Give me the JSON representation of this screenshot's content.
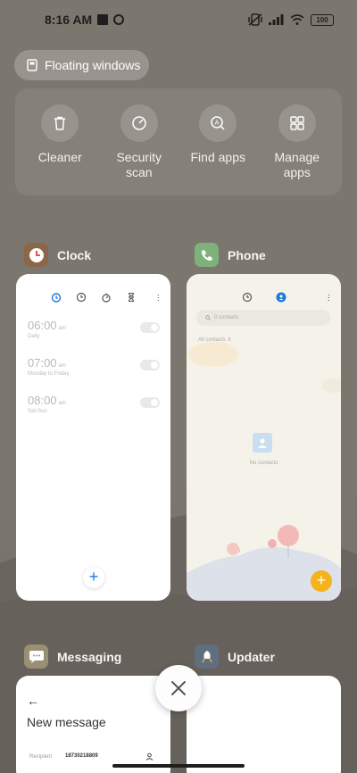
{
  "status_bar": {
    "time": "8:16 AM",
    "battery": "100"
  },
  "floating_windows": {
    "label": "Floating windows"
  },
  "tools": [
    {
      "label": "Cleaner",
      "icon": "trash-icon"
    },
    {
      "label": "Security\nscan",
      "icon": "security-icon"
    },
    {
      "label": "Find apps",
      "icon": "find-apps-icon"
    },
    {
      "label": "Manage\napps",
      "icon": "grid-icon"
    }
  ],
  "apps": {
    "clock": {
      "name": "Clock",
      "alarms": [
        {
          "time": "06:00",
          "ampm": "am",
          "days": "Daily"
        },
        {
          "time": "07:00",
          "ampm": "am",
          "days": "Monday to Friday"
        },
        {
          "time": "08:00",
          "ampm": "am",
          "days": "Sat-Sun"
        }
      ]
    },
    "phone": {
      "name": "Phone",
      "search_placeholder": "0 contacts",
      "filter": "All contacts",
      "empty": "No contacts"
    },
    "messaging": {
      "name": "Messaging",
      "back": "←",
      "title": "New message",
      "recipient_label": "Recipient",
      "recipient_number": "18730218809"
    },
    "updater": {
      "name": "Updater"
    }
  },
  "colors": {
    "clock_accent": "#1a7ad9",
    "phone_fab": "#f5b21b"
  }
}
